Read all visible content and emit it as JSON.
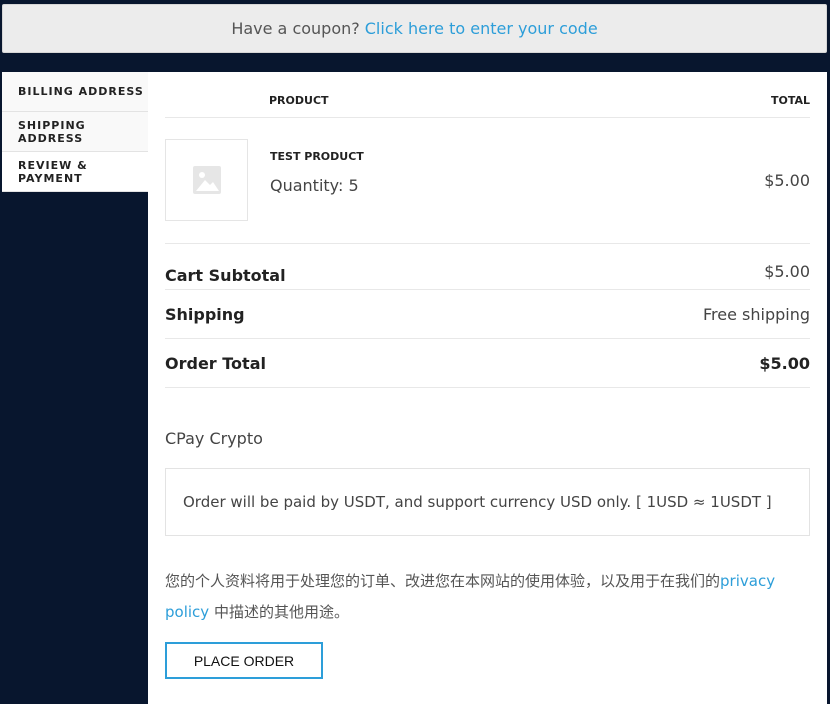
{
  "coupon": {
    "prompt": "Have a coupon?",
    "link": "Click here to enter your code"
  },
  "steps": [
    {
      "label": "BILLING ADDRESS"
    },
    {
      "label": "SHIPPING ADDRESS"
    },
    {
      "label": "REVIEW & PAYMENT"
    }
  ],
  "table": {
    "col_product": "PRODUCT",
    "col_total": "TOTAL"
  },
  "item": {
    "name": "TEST PRODUCT",
    "quantity": "Quantity: 5",
    "price": "$5.00",
    "thumbnail_icon": "image-placeholder-icon"
  },
  "totals": {
    "subtotal_label": "Cart Subtotal",
    "subtotal_value": "$5.00",
    "shipping_label": "Shipping",
    "shipping_value": "Free shipping",
    "total_label": "Order Total",
    "total_value": "$5.00"
  },
  "payment": {
    "method": "CPay Crypto",
    "description": "Order will be paid by USDT, and support currency USD only. [ 1USD ≈ 1USDT ]"
  },
  "privacy": {
    "text_before": "您的个人资料将用于处理您的订单、改进您在本网站的使用体验，以及用于在我们的",
    "link": "privacy policy",
    "text_after": " 中描述的其他用途。"
  },
  "place_order_label": "PLACE ORDER",
  "colors": {
    "background": "#08162e",
    "accent": "#2d9ed9"
  }
}
